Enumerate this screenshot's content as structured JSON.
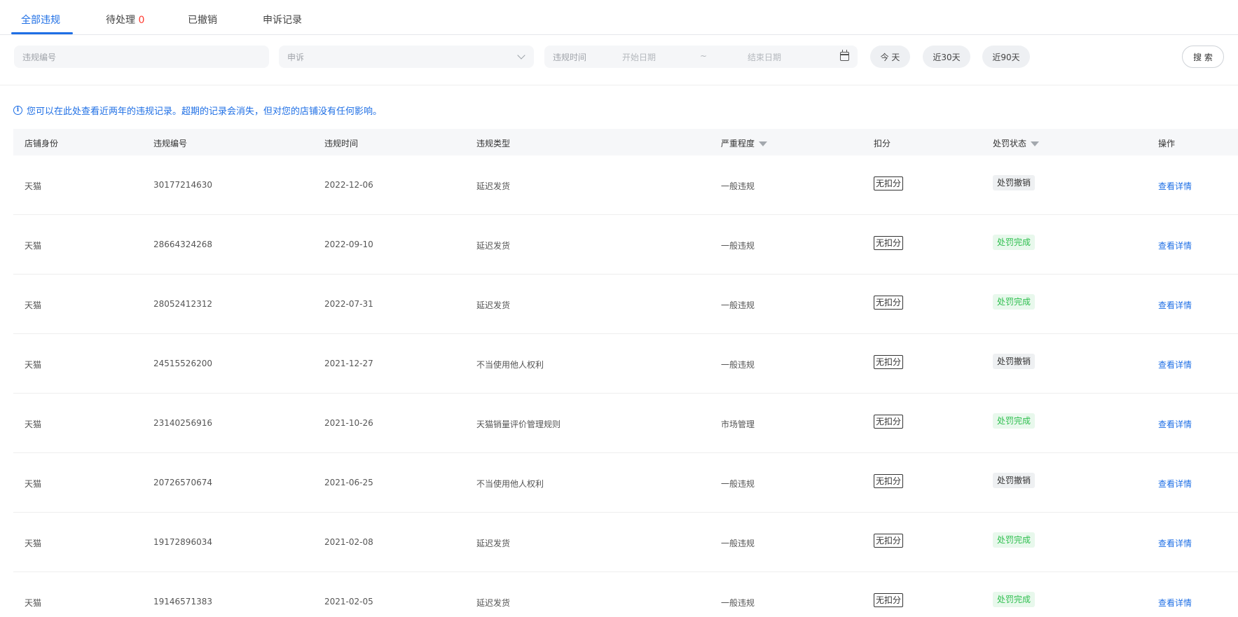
{
  "tabs": [
    {
      "label": "全部违规"
    },
    {
      "label": "待处理",
      "count": "0"
    },
    {
      "label": "已撤销"
    },
    {
      "label": "申诉记录"
    }
  ],
  "filters": {
    "violation_no_placeholder": "违规编号",
    "appeal_select_value": "申诉",
    "time_label": "违规时间",
    "start_placeholder": "开始日期",
    "range_sep": "~",
    "end_placeholder": "结束日期",
    "quick": [
      "今 天",
      "近30天",
      "近90天"
    ],
    "search_label": "搜 索"
  },
  "notice": "您可以在此处查看近两年的违规记录。超期的记录会消失，但对您的店铺没有任何影响。",
  "table": {
    "headers": [
      "店铺身份",
      "违规编号",
      "违规时间",
      "违规类型",
      "严重程度",
      "扣分",
      "处罚状态",
      "操作"
    ],
    "rows": [
      {
        "shop": "天猫",
        "no": "30177214630",
        "date": "2022-12-06",
        "type": "延迟发货",
        "severity": "一般违规",
        "score": "无扣分",
        "status": "处罚撤销",
        "status_kind": "revoked",
        "action": "查看详情"
      },
      {
        "shop": "天猫",
        "no": "28664324268",
        "date": "2022-09-10",
        "type": "延迟发货",
        "severity": "一般违规",
        "score": "无扣分",
        "status": "处罚完成",
        "status_kind": "done",
        "action": "查看详情"
      },
      {
        "shop": "天猫",
        "no": "28052412312",
        "date": "2022-07-31",
        "type": "延迟发货",
        "severity": "一般违规",
        "score": "无扣分",
        "status": "处罚完成",
        "status_kind": "done",
        "action": "查看详情"
      },
      {
        "shop": "天猫",
        "no": "24515526200",
        "date": "2021-12-27",
        "type": "不当使用他人权利",
        "severity": "一般违规",
        "score": "无扣分",
        "status": "处罚撤销",
        "status_kind": "revoked",
        "action": "查看详情"
      },
      {
        "shop": "天猫",
        "no": "23140256916",
        "date": "2021-10-26",
        "type": "天猫销量评价管理规则",
        "severity": "市场管理",
        "score": "无扣分",
        "status": "处罚完成",
        "status_kind": "done",
        "action": "查看详情"
      },
      {
        "shop": "天猫",
        "no": "20726570674",
        "date": "2021-06-25",
        "type": "不当使用他人权利",
        "severity": "一般违规",
        "score": "无扣分",
        "status": "处罚撤销",
        "status_kind": "revoked",
        "action": "查看详情"
      },
      {
        "shop": "天猫",
        "no": "19172896034",
        "date": "2021-02-08",
        "type": "延迟发货",
        "severity": "一般违规",
        "score": "无扣分",
        "status": "处罚完成",
        "status_kind": "done",
        "action": "查看详情"
      },
      {
        "shop": "天猫",
        "no": "19146571383",
        "date": "2021-02-05",
        "type": "延迟发货",
        "severity": "一般违规",
        "score": "无扣分",
        "status": "处罚完成",
        "status_kind": "done",
        "action": "查看详情"
      }
    ]
  }
}
